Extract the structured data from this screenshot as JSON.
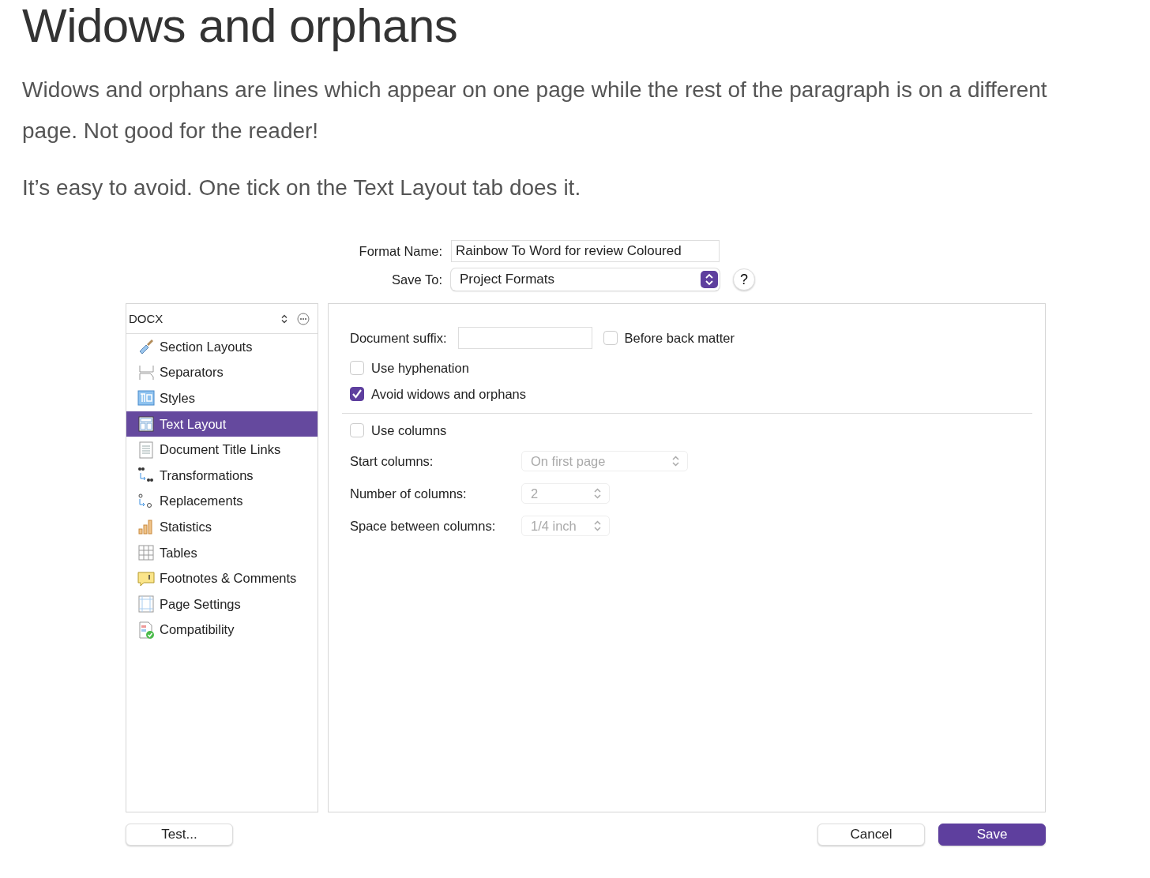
{
  "heading": "Widows and orphans",
  "paragraphs": [
    "Widows and orphans are lines which appear on one page while the rest of the paragraph is on a different page. Not good for the reader!",
    "It’s easy to avoid. One tick on the Text Layout tab does it."
  ],
  "dialog": {
    "format_name": {
      "label": "Format Name:",
      "value": "Rainbow To Word for review Coloured"
    },
    "save_to": {
      "label": "Save To:",
      "value": "Project Formats"
    },
    "help": "?",
    "sidebar": {
      "header": "DOCX",
      "items": [
        {
          "label": "Section Layouts",
          "selected": false
        },
        {
          "label": "Separators",
          "selected": false
        },
        {
          "label": "Styles",
          "selected": false
        },
        {
          "label": "Text Layout",
          "selected": true
        },
        {
          "label": "Document Title Links",
          "selected": false
        },
        {
          "label": "Transformations",
          "selected": false
        },
        {
          "label": "Replacements",
          "selected": false
        },
        {
          "label": "Statistics",
          "selected": false
        },
        {
          "label": "Tables",
          "selected": false
        },
        {
          "label": "Footnotes & Comments",
          "selected": false
        },
        {
          "label": "Page Settings",
          "selected": false
        },
        {
          "label": "Compatibility",
          "selected": false
        }
      ]
    },
    "panel": {
      "suffix_label": "Document suffix:",
      "before_back_matter": {
        "label": "Before back matter",
        "checked": false
      },
      "options": [
        {
          "label": "Use hyphenation",
          "checked": false
        },
        {
          "label": "Avoid widows and orphans",
          "checked": true
        }
      ],
      "use_columns": {
        "label": "Use columns",
        "checked": false
      },
      "column_settings": [
        {
          "label": "Start columns:",
          "value": "On first page",
          "disabled": true
        },
        {
          "label": "Number of columns:",
          "value": "2",
          "disabled": true
        },
        {
          "label": "Space between columns:",
          "value": "1/4 inch",
          "disabled": true
        }
      ]
    },
    "buttons": {
      "test": "Test...",
      "cancel": "Cancel",
      "save": "Save"
    }
  }
}
